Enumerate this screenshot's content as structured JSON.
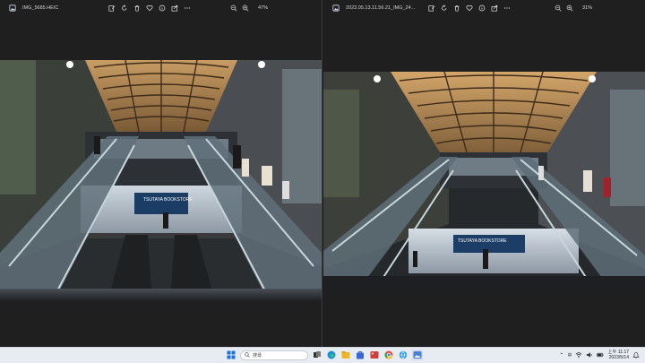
{
  "left_window": {
    "filename": "IMG_5685.HEIC",
    "zoom": "47%"
  },
  "right_window": {
    "filename": "2023.05.13.11.56.21_IMG_24...",
    "zoom": "31%"
  },
  "photo": {
    "store_sign": "TSUTAYA BOOKSTORE"
  },
  "taskbar": {
    "search_placeholder": "搜尋",
    "ime_label": "中",
    "time": "上午 11:17",
    "date": "2023/5/14"
  }
}
